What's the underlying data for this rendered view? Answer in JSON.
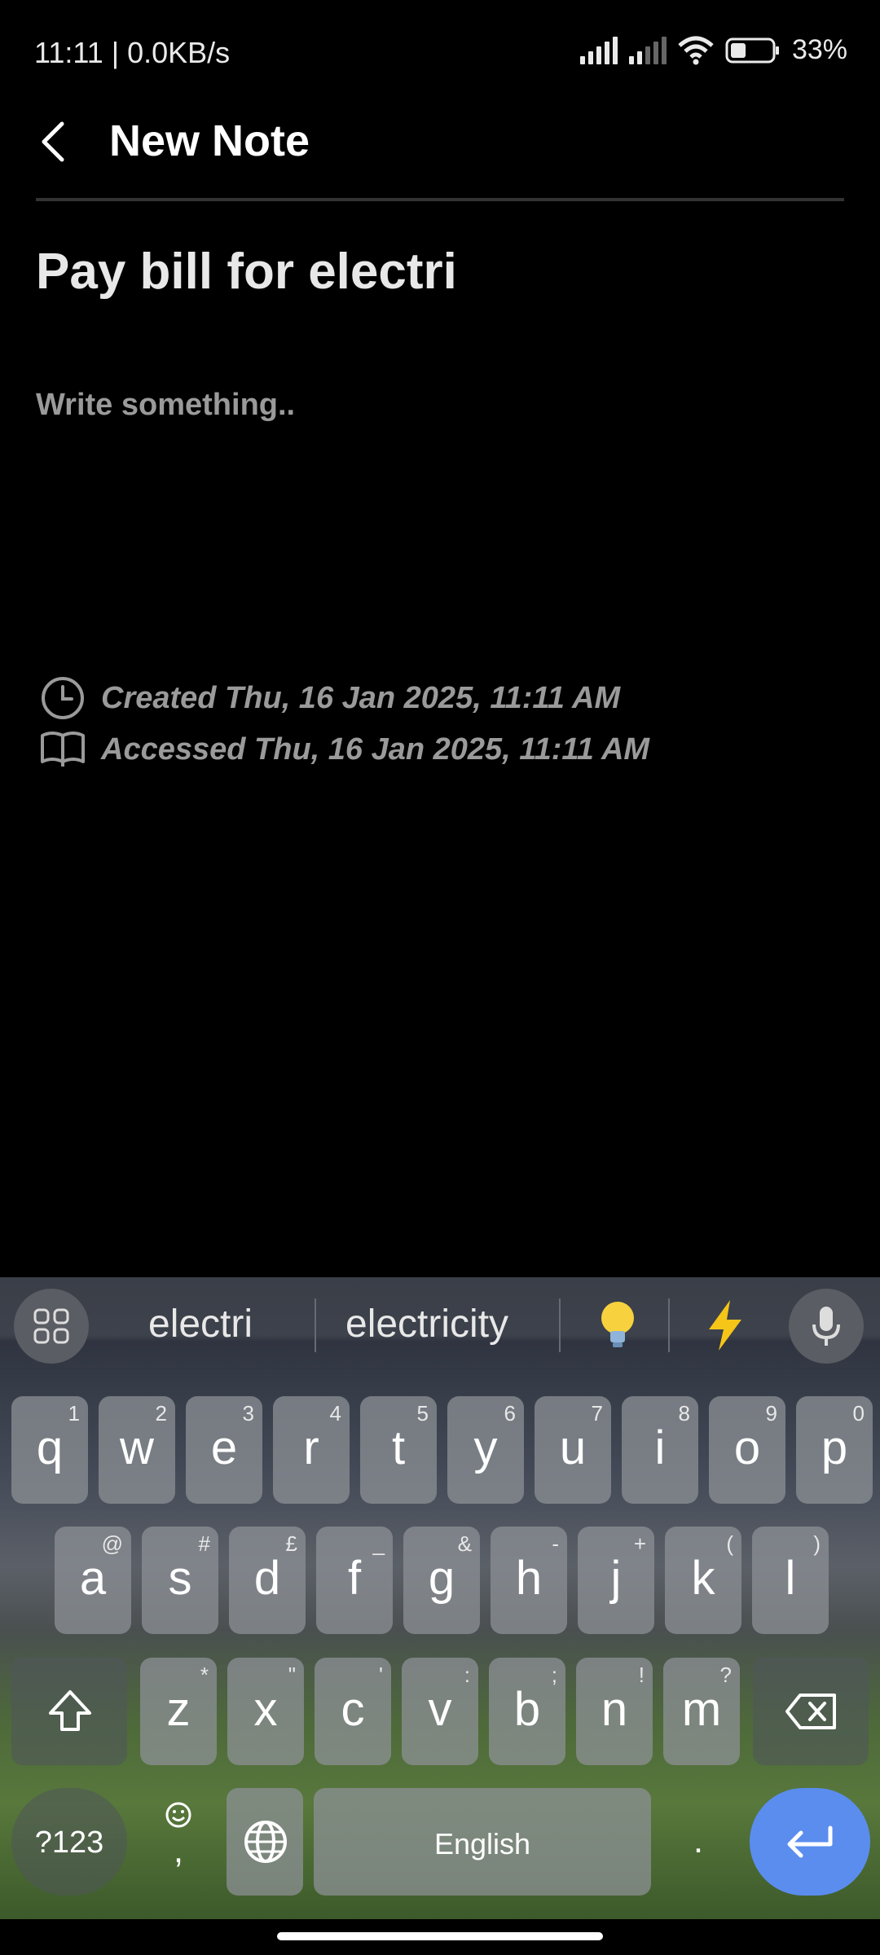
{
  "status_bar": {
    "time_speed": "11:11 | 0.0KB/s",
    "battery": "33%"
  },
  "app_bar": {
    "title": "New Note"
  },
  "note": {
    "title": "Pay bill for electri",
    "body_placeholder": "Write something..",
    "created": "Created Thu, 16 Jan 2025, 11:11 AM",
    "accessed": "Accessed Thu, 16 Jan 2025, 11:11 AM"
  },
  "keyboard": {
    "suggestions": [
      "electri",
      "electricity"
    ],
    "row1": [
      {
        "k": "q",
        "s": "1"
      },
      {
        "k": "w",
        "s": "2"
      },
      {
        "k": "e",
        "s": "3"
      },
      {
        "k": "r",
        "s": "4"
      },
      {
        "k": "t",
        "s": "5"
      },
      {
        "k": "y",
        "s": "6"
      },
      {
        "k": "u",
        "s": "7"
      },
      {
        "k": "i",
        "s": "8"
      },
      {
        "k": "o",
        "s": "9"
      },
      {
        "k": "p",
        "s": "0"
      }
    ],
    "row2": [
      {
        "k": "a",
        "s": "@"
      },
      {
        "k": "s",
        "s": "#"
      },
      {
        "k": "d",
        "s": "£"
      },
      {
        "k": "f",
        "s": "_"
      },
      {
        "k": "g",
        "s": "&"
      },
      {
        "k": "h",
        "s": "-"
      },
      {
        "k": "j",
        "s": "+"
      },
      {
        "k": "k",
        "s": "("
      },
      {
        "k": "l",
        "s": ")"
      }
    ],
    "row3": [
      {
        "k": "z",
        "s": "*"
      },
      {
        "k": "x",
        "s": "\""
      },
      {
        "k": "c",
        "s": "'"
      },
      {
        "k": "v",
        "s": ":"
      },
      {
        "k": "b",
        "s": ";"
      },
      {
        "k": "n",
        "s": "!"
      },
      {
        "k": "m",
        "s": "?"
      }
    ],
    "symbols_label": "?123",
    "comma_label": ",",
    "space_label": "English",
    "period_label": "."
  }
}
